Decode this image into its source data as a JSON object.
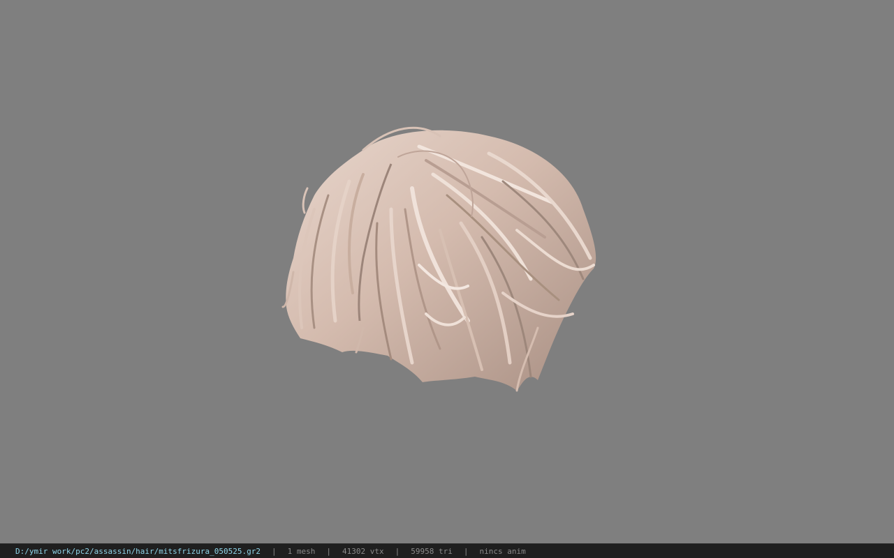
{
  "viewport": {
    "background": "#7f7f7f",
    "model_name": "hair-mesh"
  },
  "statusbar": {
    "path": "D:/ymir work/pc2/assassin/hair/mitsfrizura_050525.gr2",
    "separator": "|",
    "meshes": "1 mesh",
    "vertices": "41302 vtx",
    "triangles": "59958 tri",
    "animation": "nincs anim"
  },
  "colors": {
    "path_text": "#8fd6ea",
    "status_text": "#8a8a8a",
    "statusbar_bg": "#1f1f1f",
    "hair_light": "#e4cfc4",
    "hair_mid": "#c9aea1",
    "hair_dark": "#8f7a70"
  }
}
